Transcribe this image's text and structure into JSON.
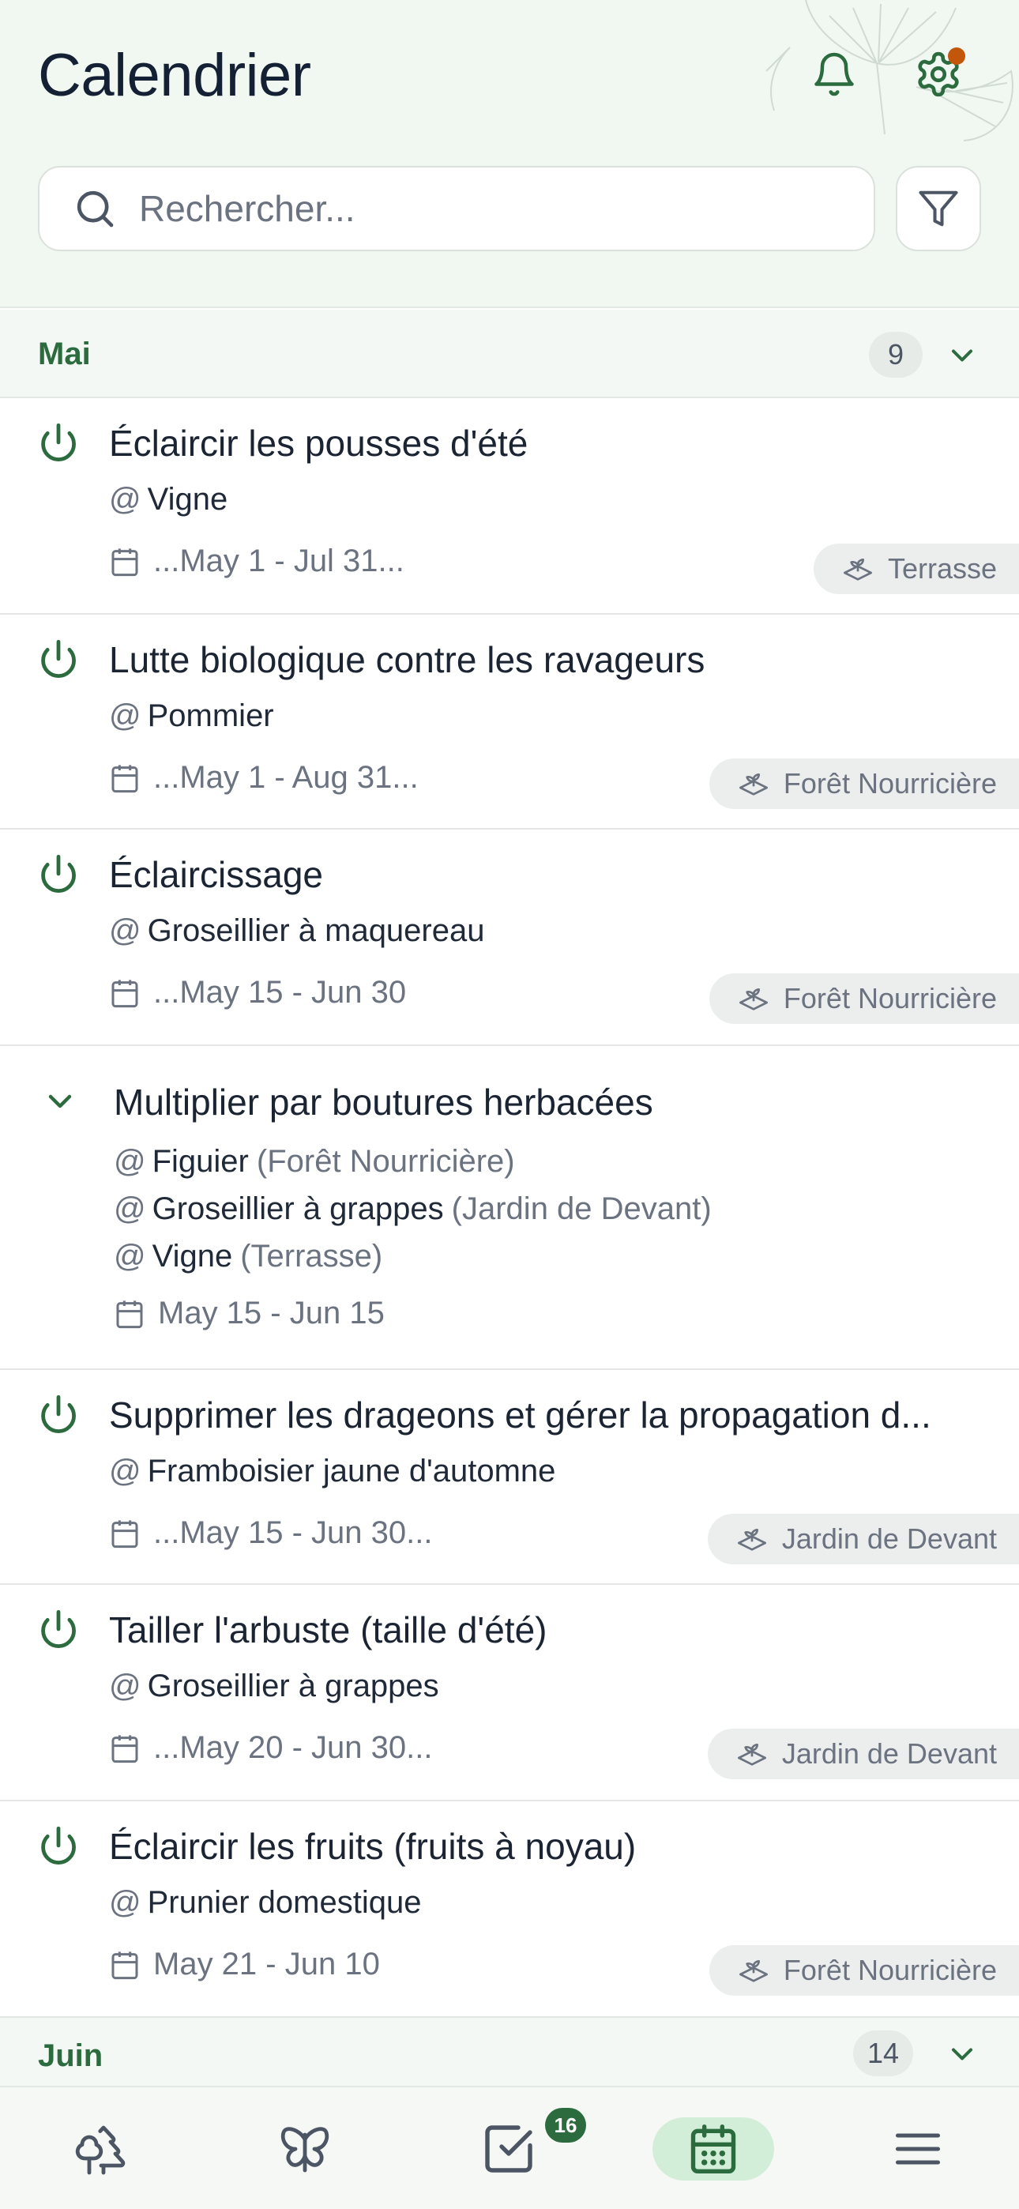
{
  "header": {
    "title": "Calendrier",
    "search_placeholder": "Rechercher..."
  },
  "months": [
    {
      "name": "Mai",
      "count": "9"
    },
    {
      "name": "Juin",
      "count": "14"
    }
  ],
  "tasks": [
    {
      "title": "Éclaircir les pousses d'été",
      "plant": "Vigne",
      "date": "...May 1 - Jul 31...",
      "location": "Terrasse"
    },
    {
      "title": "Lutte biologique contre les ravageurs",
      "plant": "Pommier",
      "date": "...May 1 - Aug 31...",
      "location": "Forêt Nourricière"
    },
    {
      "title": "Éclaircissage",
      "plant": "Groseillier à maquereau",
      "date": "...May 15 - Jun 30",
      "location": "Forêt Nourricière"
    },
    {
      "title": "Supprimer les drageons et gérer la propagation d...",
      "plant": "Framboisier jaune d'automne",
      "date": "...May 15 - Jun 30...",
      "location": "Jardin de Devant"
    },
    {
      "title": "Tailler l'arbuste (taille d'été)",
      "plant": "Groseillier à grappes",
      "date": "...May 20 - Jun 30...",
      "location": "Jardin de Devant"
    },
    {
      "title": "Éclaircir les fruits (fruits à noyau)",
      "plant": "Prunier domestique",
      "date": "May 21 - Jun 10",
      "location": "Forêt Nourricière"
    }
  ],
  "group_task": {
    "title": "Multiplier par boutures herbacées",
    "items": [
      {
        "plant": "Figuier",
        "location": "(Forêt Nourricière)"
      },
      {
        "plant": "Groseillier à grappes",
        "location": "(Jardin de Devant)"
      },
      {
        "plant": "Vigne",
        "location": "(Terrasse)"
      }
    ],
    "date": "May 15 - Jun 15"
  },
  "nav": {
    "tasks_badge": "16",
    "active": "calendar"
  },
  "colors": {
    "accent": "#2b6b3e",
    "header_bg": "#f0f8f1",
    "notification_dot": "#c2570c"
  }
}
